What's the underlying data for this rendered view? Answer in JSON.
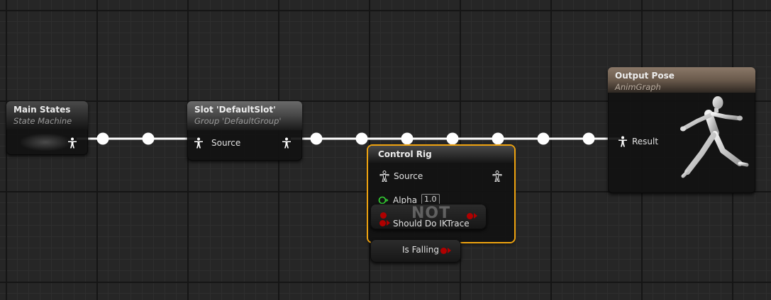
{
  "colors": {
    "wire": "#ffffff",
    "selection": "#f0a410",
    "bool_pin": "#b00000",
    "float_pin": "#35d435",
    "output_header": "#8a7868"
  },
  "nodes": {
    "main_states": {
      "title": "Main States",
      "subtitle": "State Machine",
      "output_icon": "pose-pin-icon"
    },
    "slot": {
      "title": "Slot 'DefaultSlot'",
      "subtitle": "Group 'DefaultGroup'",
      "input_label": "Source",
      "pin_icon": "pose-pin-icon"
    },
    "control_rig": {
      "title": "Control Rig",
      "source_label": "Source",
      "alpha_label": "Alpha",
      "alpha_value": "1.0",
      "bool_input_label": "Should Do IKTrace",
      "selected": true
    },
    "not_node": {
      "title": "NOT"
    },
    "is_falling": {
      "label": "Is Falling"
    },
    "output_pose": {
      "title": "Output Pose",
      "subtitle": "AnimGraph",
      "input_label": "Result",
      "preview_icon": "running-mannequin-icon"
    }
  }
}
